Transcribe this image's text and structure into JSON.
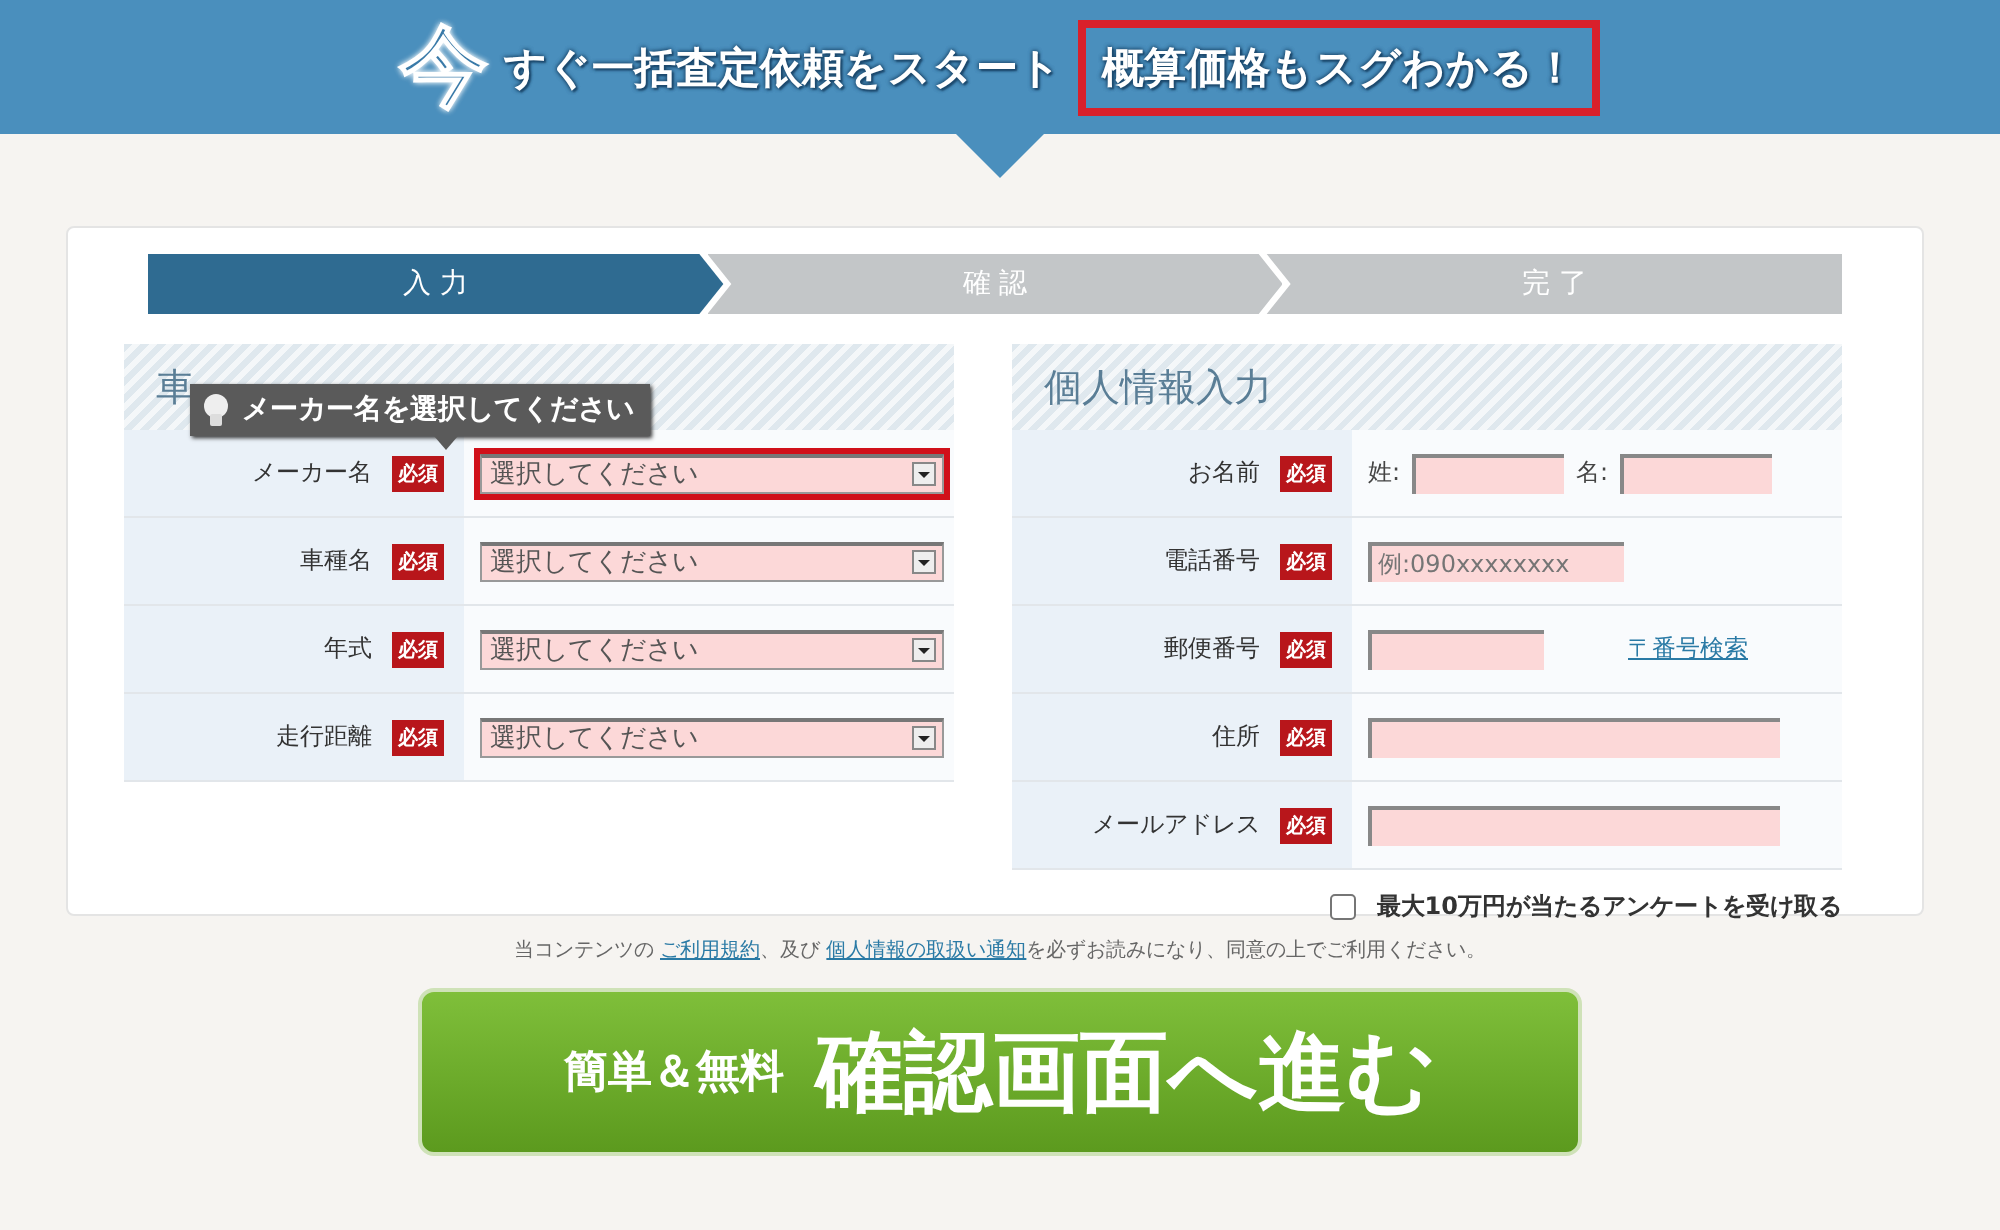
{
  "banner": {
    "lead_char": "今",
    "lead": "すぐ一括査定依頼をスタート",
    "highlight": "概算価格もスグわかる！"
  },
  "steps": [
    {
      "label": "入 力",
      "selected": true
    },
    {
      "label": "確 認",
      "selected": false
    },
    {
      "label": "完 了",
      "selected": false
    }
  ],
  "vehicle": {
    "title": "車",
    "tooltip": "メーカー名を選択してください",
    "fields": [
      {
        "label": "メーカー名",
        "badge": "必須",
        "value": "選択してください",
        "error": true
      },
      {
        "label": "車種名",
        "badge": "必須",
        "value": "選択してください",
        "error": false
      },
      {
        "label": "年式",
        "badge": "必須",
        "value": "選択してください",
        "error": false
      },
      {
        "label": "走行距離",
        "badge": "必須",
        "value": "選択してください",
        "error": false
      }
    ]
  },
  "personal": {
    "title": "個人情報入力",
    "fields": [
      {
        "kind": "name",
        "label": "お名前",
        "badge": "必須",
        "sei": "姓:",
        "mei": "名:"
      },
      {
        "kind": "text",
        "label": "電話番号",
        "badge": "必須",
        "placeholder": "例:090xxxxxxxx"
      },
      {
        "kind": "zip",
        "label": "郵便番号",
        "badge": "必須",
        "link": "〒番号検索"
      },
      {
        "kind": "wide",
        "label": "住所",
        "badge": "必須"
      },
      {
        "kind": "wide",
        "label": "メールアドレス",
        "badge": "必須"
      }
    ],
    "survey": {
      "label": "最大10万円が当たるアンケートを受け取る",
      "checked": false
    }
  },
  "notice": [
    {
      "kind": "text",
      "text": "当コンテンツの "
    },
    {
      "kind": "link",
      "text": "ご利用規約"
    },
    {
      "kind": "text",
      "text": "、及び "
    },
    {
      "kind": "link",
      "text": "個人情報の取扱い通知"
    },
    {
      "kind": "text",
      "text": "を必ずお読みになり、同意の上でご利用ください。"
    }
  ],
  "submit": {
    "sub": "簡単＆無料",
    "main": "確認画面へ進む"
  }
}
